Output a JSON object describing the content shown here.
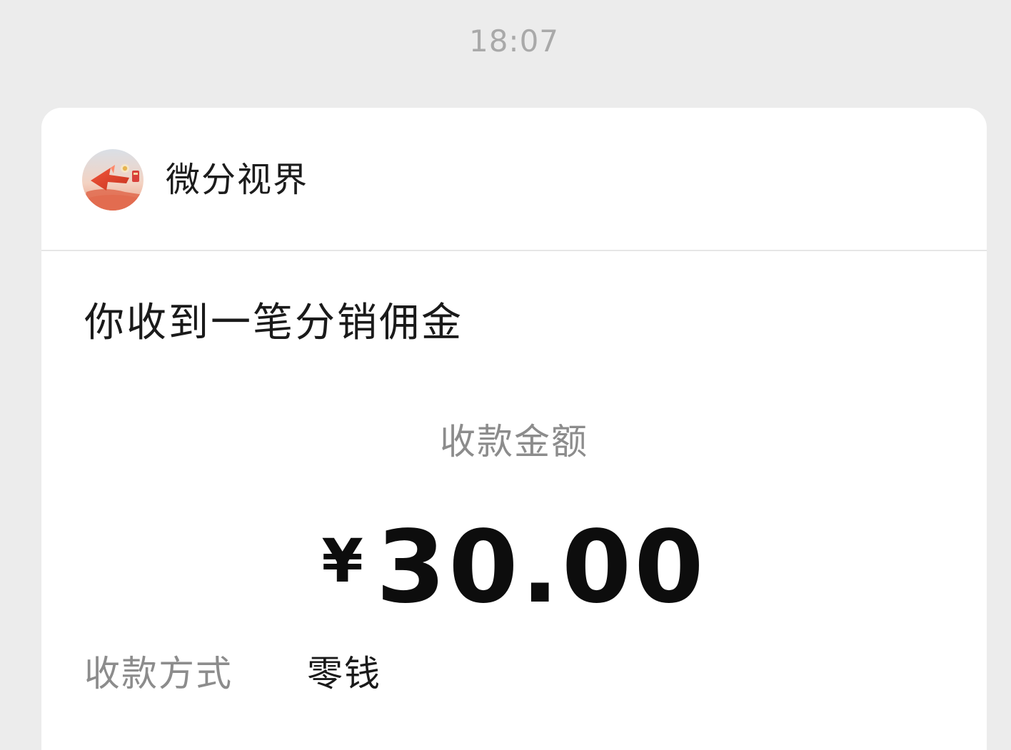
{
  "message": {
    "time": "18:07"
  },
  "sender": {
    "name": "微分视界",
    "avatar_icon": "rocket-arrow-logo-icon"
  },
  "notice": {
    "title": "你收到一笔分销佣金",
    "amount_label": "收款金额",
    "currency_symbol": "¥",
    "amount": "30.00",
    "method_label": "收款方式",
    "method_value": "零钱"
  },
  "colors": {
    "background": "#ececec",
    "card": "#ffffff",
    "timestamp": "#a9a9a9",
    "secondary_text": "#8c8c8c",
    "primary_text": "#1a1a1a",
    "amount_text": "#0d0d0d",
    "divider": "#e6e6e6",
    "avatar_accent": "#e8563b"
  }
}
